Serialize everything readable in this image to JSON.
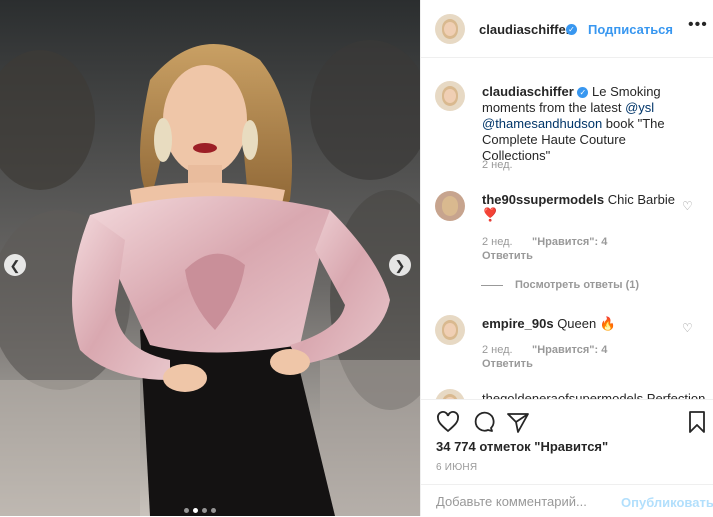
{
  "header": {
    "username": "claudiaschiffer",
    "follow_label": "Подписаться",
    "more_icon": "more-horizontal-icon"
  },
  "caption": {
    "username": "claudiaschiffer",
    "text_before": "Le Smoking moments from the latest ",
    "mention1": "@ysl",
    "mention2": "@thamesandhudson",
    "text_after": " book \"The Complete Haute Couture Collections\"",
    "time": "2 нед."
  },
  "comments": [
    {
      "username": "the90ssupermodels",
      "text": "Chic Barbie",
      "emoji": "❣️",
      "time": "2 нед.",
      "likes": "\"Нравится\": 4",
      "reply": "Ответить"
    },
    {
      "username": "empire_90s",
      "text": "Queen",
      "emoji": "🔥",
      "time": "2 нед.",
      "likes": "\"Нравится\": 4",
      "reply": "Ответить"
    }
  ],
  "view_replies": "Посмотреть ответы (1)",
  "partial_comment": "thegoldeneraofsupermodels Perfection ❤️",
  "actions": {
    "like_icon": "heart-icon",
    "comment_icon": "comment-icon",
    "share_icon": "share-icon",
    "save_icon": "bookmark-icon",
    "likes_count": "34 774 отметок \"Нравится\"",
    "date": "6 июня"
  },
  "add_comment": {
    "placeholder": "Добавьте комментарий...",
    "publish_label": "Опубликовать"
  },
  "carousel": {
    "prev_icon": "chevron-left-icon",
    "next_icon": "chevron-right-icon",
    "slide_count": 4,
    "active_slide": 2
  },
  "colors": {
    "accent": "#3897f0",
    "text": "#262626",
    "muted": "#999999",
    "like_red": "#ed4956"
  }
}
